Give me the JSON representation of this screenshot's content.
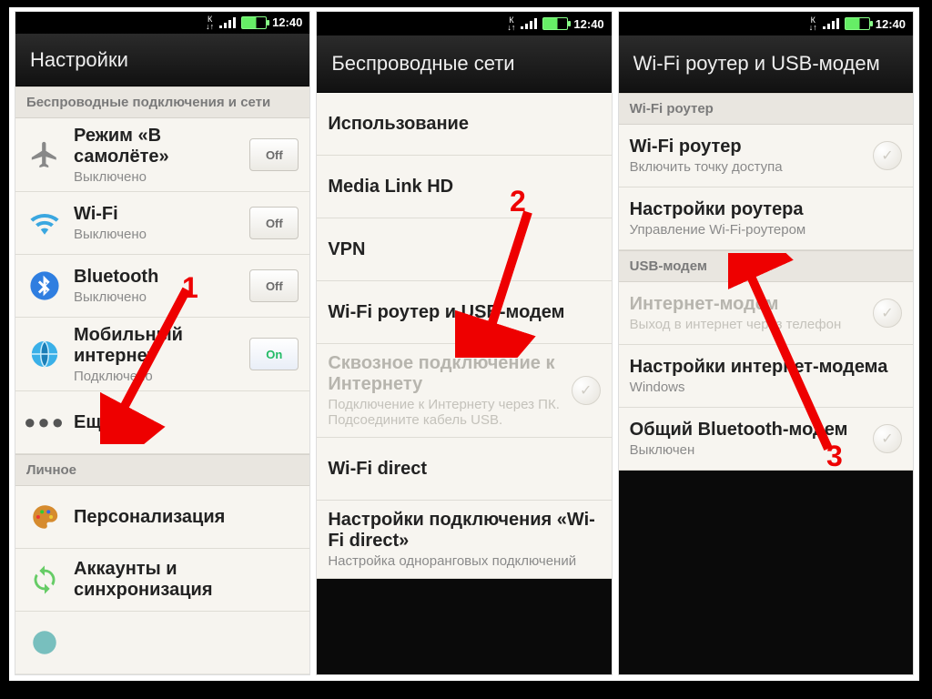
{
  "status": {
    "time": "12:40"
  },
  "annotations": {
    "n1": "1",
    "n2": "2",
    "n3": "3"
  },
  "phone1": {
    "title": "Настройки",
    "section_wireless": "Беспроводные подключения и сети",
    "section_personal": "Личное",
    "rows": {
      "airplane": {
        "title": "Режим «В самолёте»",
        "sub": "Выключено",
        "toggle": "Off"
      },
      "wifi": {
        "title": "Wi-Fi",
        "sub": "Выключено",
        "toggle": "Off"
      },
      "bluetooth": {
        "title": "Bluetooth",
        "sub": "Выключено",
        "toggle": "Off"
      },
      "mobile": {
        "title": "Мобильный интернет",
        "sub": "Подключено",
        "toggle": "On"
      },
      "more": {
        "title": "Ещё"
      },
      "personalize": {
        "title": "Персонализация"
      },
      "accounts": {
        "title": "Аккаунты и синхронизация"
      }
    }
  },
  "phone2": {
    "title": "Беспроводные сети",
    "rows": {
      "usage": "Использование",
      "medialink": "Media Link HD",
      "vpn": "VPN",
      "wifi_router_usb": "Wi-Fi роутер и USB-модем",
      "passthrough": {
        "title": "Сквозное подключение к Интернету",
        "sub": "Подключение к Интернету через ПК. Подсоедините кабель USB."
      },
      "wifi_direct": "Wi-Fi direct",
      "wifi_direct_settings": {
        "title": "Настройки подключения «Wi-Fi direct»",
        "sub": "Настройка одноранговых подключений"
      }
    }
  },
  "phone3": {
    "title": "Wi-Fi роутер и USB-модем",
    "section_wifi": "Wi-Fi роутер",
    "section_usb": "USB-модем",
    "rows": {
      "wifi_router": {
        "title": "Wi-Fi роутер",
        "sub": "Включить точку доступа"
      },
      "router_settings": {
        "title": "Настройки роутера",
        "sub": "Управление Wi-Fi-роутером"
      },
      "internet_modem": {
        "title": "Интернет-модем",
        "sub": "Выход в интернет через телефон"
      },
      "modem_settings": {
        "title": "Настройки интернет-модема",
        "sub": "Windows"
      },
      "bt_modem": {
        "title": "Общий Bluetooth-модем",
        "sub": "Выключен"
      }
    }
  }
}
